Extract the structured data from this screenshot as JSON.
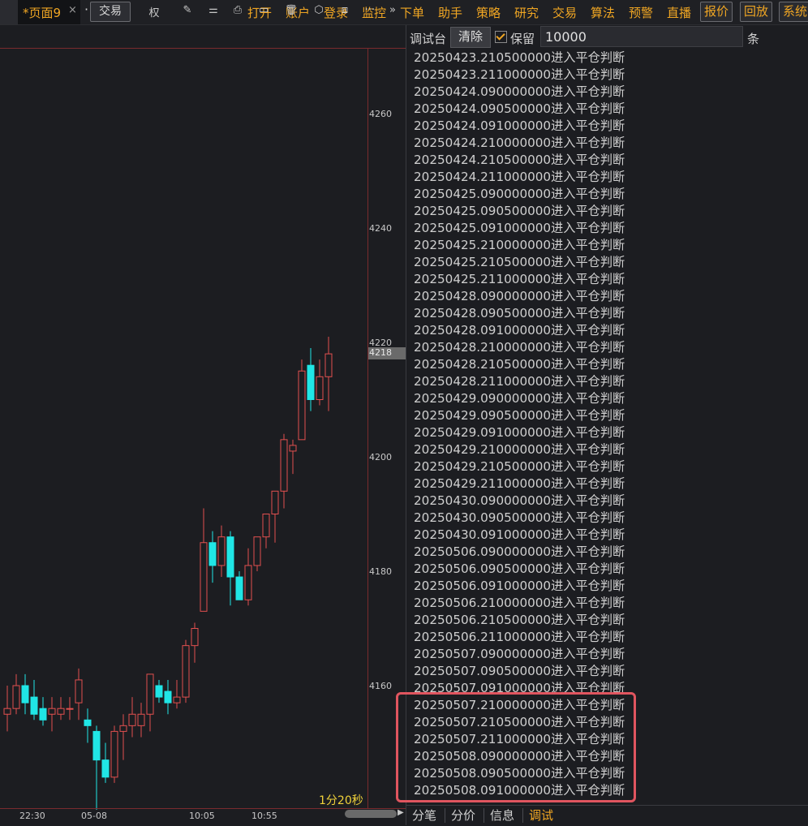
{
  "tabbar": {
    "page_tab": "*页面9",
    "close": "×",
    "more": "···",
    "add": "+"
  },
  "menu": [
    "打开",
    "账户",
    "登录",
    "监控",
    "下单",
    "助手",
    "策略",
    "研究",
    "交易",
    "算法",
    "预警",
    "直播"
  ],
  "menu_buttons": [
    "报价",
    "回放",
    "系统"
  ],
  "chart_toolbar": {
    "trade_button": "交易",
    "icons": [
      "权",
      "✎",
      "⚌",
      "⎙",
      "▭",
      "🗑",
      "⬡",
      "⧈",
      "···",
      "»"
    ]
  },
  "chart": {
    "price_ticks": [
      "4260",
      "4240",
      "4220",
      "4200",
      "4180",
      "4160"
    ],
    "current_price": "4218",
    "time_ticks": [
      "22:30",
      "05-08",
      "10:05",
      "10:55"
    ],
    "timeframe": "1分20秒",
    "up_color": "#e2504f",
    "down_color": "#20e6e6"
  },
  "chart_data": {
    "type": "candlestick",
    "ylim": [
      4150,
      4270
    ],
    "y_ticks": [
      4260,
      4240,
      4220,
      4200,
      4180,
      4160
    ],
    "x_ticks": [
      "22:30",
      "05-08",
      "10:05",
      "10:55"
    ],
    "current_price": 4218,
    "candles": [
      {
        "o": 4155,
        "h": 4160,
        "l": 4152,
        "c": 4156
      },
      {
        "o": 4156,
        "h": 4162,
        "l": 4155,
        "c": 4160
      },
      {
        "o": 4160,
        "h": 4162,
        "l": 4155,
        "c": 4157
      },
      {
        "o": 4158,
        "h": 4161,
        "l": 4154,
        "c": 4155
      },
      {
        "o": 4156,
        "h": 4158,
        "l": 4153,
        "c": 4154
      },
      {
        "o": 4155,
        "h": 4158,
        "l": 4152,
        "c": 4156
      },
      {
        "o": 4155,
        "h": 4158,
        "l": 4154,
        "c": 4156
      },
      {
        "o": 4156,
        "h": 4158,
        "l": 4154,
        "c": 4156
      },
      {
        "o": 4157,
        "h": 4163,
        "l": 4154,
        "c": 4161
      },
      {
        "o": 4154,
        "h": 4156,
        "l": 4150,
        "c": 4153
      },
      {
        "o": 4152,
        "h": 4153,
        "l": 4138,
        "c": 4147
      },
      {
        "o": 4147,
        "h": 4150,
        "l": 4143,
        "c": 4144
      },
      {
        "o": 4144,
        "h": 4153,
        "l": 4143,
        "c": 4152
      },
      {
        "o": 4152,
        "h": 4155,
        "l": 4147,
        "c": 4153
      },
      {
        "o": 4153,
        "h": 4158,
        "l": 4151,
        "c": 4155
      },
      {
        "o": 4153,
        "h": 4157,
        "l": 4151,
        "c": 4155
      },
      {
        "o": 4155,
        "h": 4162,
        "l": 4152,
        "c": 4162
      },
      {
        "o": 4160,
        "h": 4161,
        "l": 4157,
        "c": 4158
      },
      {
        "o": 4159,
        "h": 4161,
        "l": 4155,
        "c": 4157
      },
      {
        "o": 4157,
        "h": 4161,
        "l": 4156,
        "c": 4158
      },
      {
        "o": 4158,
        "h": 4168,
        "l": 4157,
        "c": 4167
      },
      {
        "o": 4167,
        "h": 4171,
        "l": 4164,
        "c": 4170
      },
      {
        "o": 4173,
        "h": 4191,
        "l": 4173,
        "c": 4185
      },
      {
        "o": 4185,
        "h": 4187,
        "l": 4178,
        "c": 4181
      },
      {
        "o": 4181,
        "h": 4188,
        "l": 4179,
        "c": 4186
      },
      {
        "o": 4186,
        "h": 4187,
        "l": 4174,
        "c": 4179
      },
      {
        "o": 4179,
        "h": 4180,
        "l": 4175,
        "c": 4175
      },
      {
        "o": 4175,
        "h": 4184,
        "l": 4174,
        "c": 4181
      },
      {
        "o": 4181,
        "h": 4186,
        "l": 4180,
        "c": 4186
      },
      {
        "o": 4186,
        "h": 4188,
        "l": 4184,
        "c": 4190
      },
      {
        "o": 4190,
        "h": 4194,
        "l": 4185,
        "c": 4194
      },
      {
        "o": 4194,
        "h": 4204,
        "l": 4191,
        "c": 4203
      },
      {
        "o": 4201,
        "h": 4203,
        "l": 4197,
        "c": 4202
      },
      {
        "o": 4203,
        "h": 4217,
        "l": 4203,
        "c": 4215
      },
      {
        "o": 4216,
        "h": 4219,
        "l": 4208,
        "c": 4210
      },
      {
        "o": 4210,
        "h": 4217,
        "l": 4209,
        "c": 4214
      },
      {
        "o": 4214,
        "h": 4221,
        "l": 4208,
        "c": 4218
      }
    ]
  },
  "debug": {
    "title": "调试台",
    "clear": "清除",
    "keep_label": "保留",
    "keep_value": "10000",
    "unit": "条",
    "lines": [
      "20250423.210500000进入平仓判断",
      "20250423.211000000进入平仓判断",
      "20250424.090000000进入平仓判断",
      "20250424.090500000进入平仓判断",
      "20250424.091000000进入平仓判断",
      "20250424.210000000进入平仓判断",
      "20250424.210500000进入平仓判断",
      "20250424.211000000进入平仓判断",
      "20250425.090000000进入平仓判断",
      "20250425.090500000进入平仓判断",
      "20250425.091000000进入平仓判断",
      "20250425.210000000进入平仓判断",
      "20250425.210500000进入平仓判断",
      "20250425.211000000进入平仓判断",
      "20250428.090000000进入平仓判断",
      "20250428.090500000进入平仓判断",
      "20250428.091000000进入平仓判断",
      "20250428.210000000进入平仓判断",
      "20250428.210500000进入平仓判断",
      "20250428.211000000进入平仓判断",
      "20250429.090000000进入平仓判断",
      "20250429.090500000进入平仓判断",
      "20250429.091000000进入平仓判断",
      "20250429.210000000进入平仓判断",
      "20250429.210500000进入平仓判断",
      "20250429.211000000进入平仓判断",
      "20250430.090000000进入平仓判断",
      "20250430.090500000进入平仓判断",
      "20250430.091000000进入平仓判断",
      "20250506.090000000进入平仓判断",
      "20250506.090500000进入平仓判断",
      "20250506.091000000进入平仓判断",
      "20250506.210000000进入平仓判断",
      "20250506.210500000进入平仓判断",
      "20250506.211000000进入平仓判断",
      "20250507.090000000进入平仓判断",
      "20250507.090500000进入平仓判断",
      "20250507.091000000进入平仓判断",
      "20250507.210000000进入平仓判断",
      "20250507.210500000进入平仓判断",
      "20250507.211000000进入平仓判断",
      "20250508.090000000进入平仓判断",
      "20250508.090500000进入平仓判断",
      "20250508.091000000进入平仓判断"
    ],
    "highlight_color": "#e0555f"
  },
  "bottom_tabs": [
    "分笔",
    "分价",
    "信息",
    "调试"
  ],
  "active_tab_color": "#f0a623"
}
